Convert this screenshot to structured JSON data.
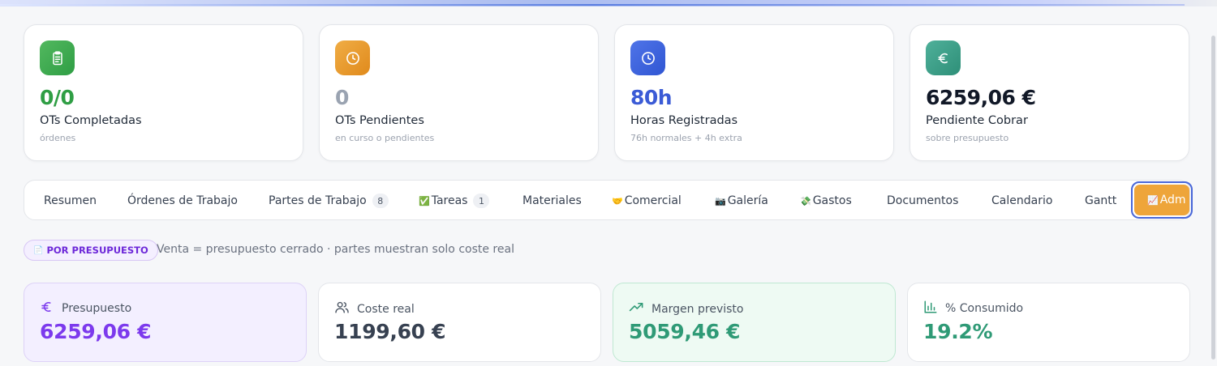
{
  "colors": {
    "green": "#2f9e44",
    "gray_value": "#9aa3b1",
    "blue": "#3b5bd6",
    "dark": "#111827",
    "purple": "#7c3aed",
    "teal": "#2f9a76",
    "tab_active_bg": "#eea53a"
  },
  "stats": [
    {
      "icon": "clipboard-icon",
      "value": "0/0",
      "label": "OTs Completadas",
      "sub": "órdenes"
    },
    {
      "icon": "clock-icon",
      "value": "0",
      "label": "OTs Pendientes",
      "sub": "en curso o pendientes"
    },
    {
      "icon": "clock-icon",
      "value": "80h",
      "label": "Horas Registradas",
      "sub": "76h normales + 4h extra"
    },
    {
      "icon": "euro-icon",
      "value": "6259,06 €",
      "label": "Pendiente Cobrar",
      "sub": "sobre presupuesto"
    }
  ],
  "tabs": [
    {
      "label": "Resumen"
    },
    {
      "label": "Órdenes de Trabajo"
    },
    {
      "label": "Partes de Trabajo",
      "badge": "8"
    },
    {
      "emoji": "✅",
      "label": "Tareas",
      "badge": "1"
    },
    {
      "label": "Materiales"
    },
    {
      "emoji": "🤝",
      "label": "Comercial"
    },
    {
      "emoji": "📷",
      "label": "Galería"
    },
    {
      "emoji": "💸",
      "label": "Gastos"
    },
    {
      "label": "Documentos"
    },
    {
      "label": "Calendario"
    },
    {
      "label": "Gantt"
    },
    {
      "emoji": "📈",
      "label": "Adm",
      "active": true
    }
  ],
  "mode": {
    "emoji": "📄",
    "pill": "POR PRESUPUESTO",
    "description": "Venta = presupuesto cerrado · partes muestran solo coste real"
  },
  "budget": [
    {
      "icon": "euro-icon",
      "label": "Presupuesto",
      "value": "6259,06 €"
    },
    {
      "icon": "users-icon",
      "label": "Coste real",
      "value": "1199,60 €"
    },
    {
      "icon": "trending-up-icon",
      "label": "Margen previsto",
      "value": "5059,46 €"
    },
    {
      "icon": "bar-chart-icon",
      "label": "% Consumido",
      "value": "19.2%"
    }
  ]
}
